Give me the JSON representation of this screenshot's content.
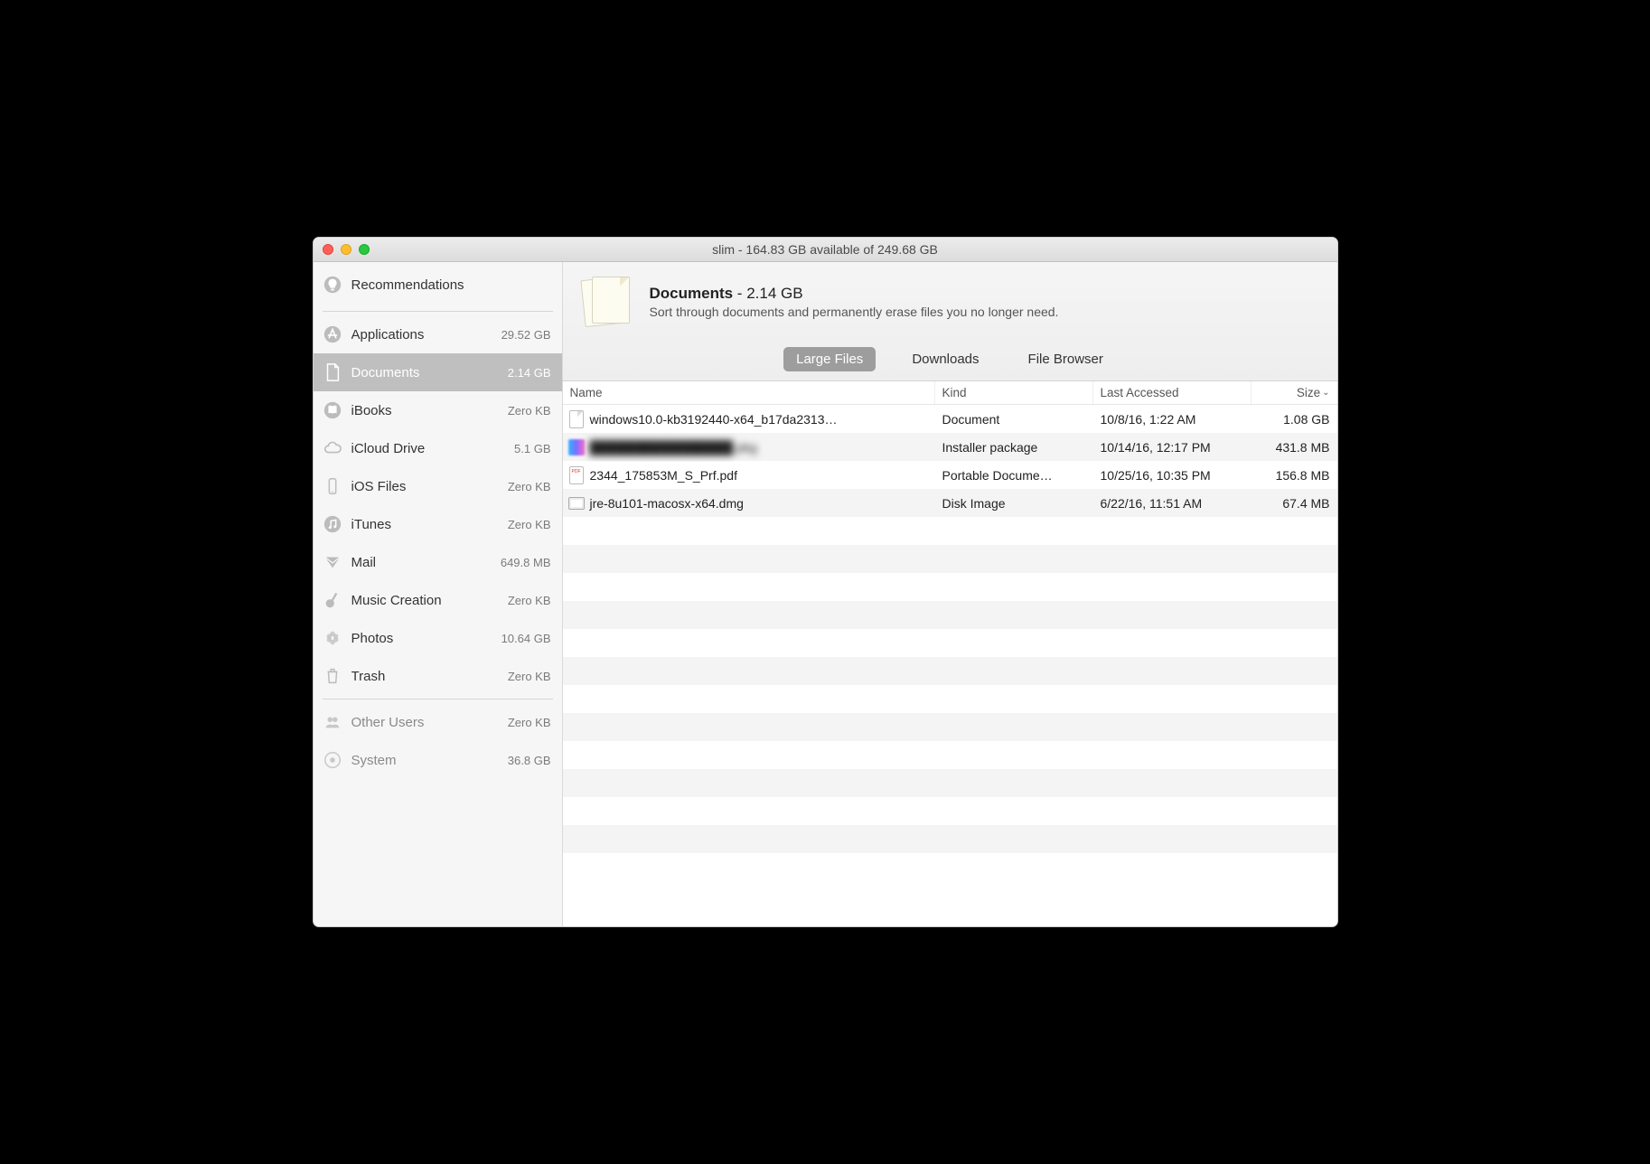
{
  "title": "slim - 164.83 GB available of 249.68 GB",
  "sidebar": {
    "items": [
      {
        "label": "Recommendations",
        "size": ""
      },
      {
        "label": "Applications",
        "size": "29.52 GB"
      },
      {
        "label": "Documents",
        "size": "2.14 GB",
        "selected": true
      },
      {
        "label": "iBooks",
        "size": "Zero KB"
      },
      {
        "label": "iCloud Drive",
        "size": "5.1 GB"
      },
      {
        "label": "iOS Files",
        "size": "Zero KB"
      },
      {
        "label": "iTunes",
        "size": "Zero KB"
      },
      {
        "label": "Mail",
        "size": "649.8 MB"
      },
      {
        "label": "Music Creation",
        "size": "Zero KB"
      },
      {
        "label": "Photos",
        "size": "10.64 GB"
      },
      {
        "label": "Trash",
        "size": "Zero KB"
      },
      {
        "label": "Other Users",
        "size": "Zero KB"
      },
      {
        "label": "System",
        "size": "36.8 GB"
      }
    ]
  },
  "header": {
    "title_bold": "Documents",
    "title_sep": " - ",
    "title_size": "2.14 GB",
    "subtitle": "Sort through documents and permanently erase files you no longer need."
  },
  "tabs": [
    "Large Files",
    "Downloads",
    "File Browser"
  ],
  "columns": {
    "name": "Name",
    "kind": "Kind",
    "last": "Last Accessed",
    "size": "Size"
  },
  "rows": [
    {
      "name": "windows10.0-kb3192440-x64_b17da2313…",
      "kind": "Document",
      "last": "10/8/16, 1:22 AM",
      "size": "1.08 GB",
      "icon": "doc"
    },
    {
      "name": "████████████████.pkg",
      "kind": "Installer package",
      "last": "10/14/16, 12:17 PM",
      "size": "431.8 MB",
      "icon": "pkg",
      "blurred": true
    },
    {
      "name": "2344_175853M_S_Prf.pdf",
      "kind": "Portable Docume…",
      "last": "10/25/16, 10:35 PM",
      "size": "156.8 MB",
      "icon": "pdf"
    },
    {
      "name": "jre-8u101-macosx-x64.dmg",
      "kind": "Disk Image",
      "last": "6/22/16, 11:51 AM",
      "size": "67.4 MB",
      "icon": "dmg"
    }
  ]
}
